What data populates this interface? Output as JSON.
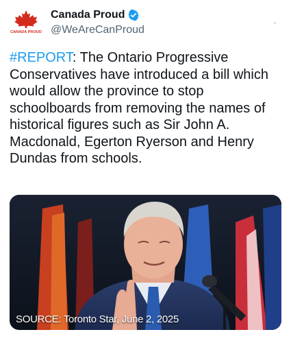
{
  "author": {
    "display_name": "Canada Proud",
    "handle": "@WeAreCanProud",
    "avatar_text": "CANADA PROUD",
    "verified": true
  },
  "tweet": {
    "hashtag": "#REPORT",
    "body": ": The Ontario Progressive Conservatives have introduced a bill which would allow the province to stop schoolboards from removing the names of historical figures such as Sir John A. Macdonald, Egerton Ryerson and Henry Dundas from schools."
  },
  "media": {
    "caption": "SOURCE: Toronto Star, June 2, 2025"
  },
  "colors": {
    "hashtag": "#1d9bf0",
    "verified_badge": "#1d9bf0",
    "handle": "#536471",
    "maple_leaf": "#d52b1e"
  }
}
